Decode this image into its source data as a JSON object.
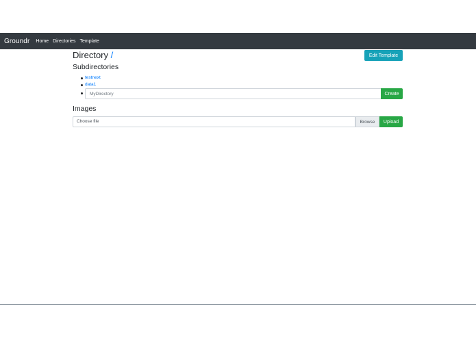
{
  "navbar": {
    "brand": "Groundr",
    "links": [
      "Home",
      "Directories",
      "Template"
    ]
  },
  "directory": {
    "title": "Directory",
    "path": "/",
    "edit_template_label": "Edit Template"
  },
  "subdirectories": {
    "heading": "Subdirectories",
    "items": [
      "testnext",
      "data1"
    ],
    "new_input_placeholder": "MyDirectory",
    "create_label": "Create"
  },
  "images": {
    "heading": "Images",
    "file_placeholder": "Choose file",
    "browse_label": "Browse",
    "upload_label": "Upload"
  },
  "colors": {
    "navbar_bg": "#343a40",
    "link": "#007bff",
    "info": "#17a2b8",
    "success": "#28a745"
  }
}
